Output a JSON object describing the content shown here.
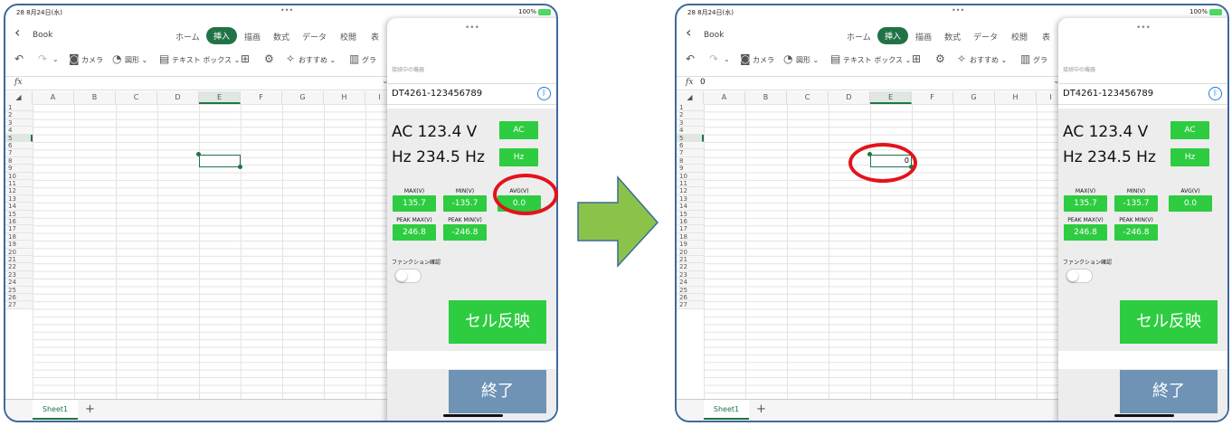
{
  "status": {
    "time": "28  8月24日(水)",
    "dots": "•••",
    "battery": "100%"
  },
  "titlebar": {
    "back": "‹",
    "book": "Book",
    "tabs": [
      "ホーム",
      "挿入",
      "描画",
      "数式",
      "データ",
      "校閲",
      "表"
    ],
    "active_tab": "挿入"
  },
  "ribbon": {
    "items": [
      "カメラ",
      "図形 ⌄",
      "テキスト ボックス ⌄",
      "おすすめ ⌄",
      "グラ"
    ]
  },
  "formula": {
    "fx": "fx",
    "left_value": "",
    "right_value": "0"
  },
  "grid": {
    "columns": [
      "A",
      "B",
      "C",
      "D",
      "E",
      "F",
      "G",
      "H",
      "I"
    ],
    "rows": [
      "1",
      "2",
      "3",
      "4",
      "5",
      "6",
      "7",
      "8",
      "9",
      "10",
      "11",
      "12",
      "13",
      "14",
      "15",
      "16",
      "17",
      "18",
      "19",
      "20",
      "21",
      "22",
      "23",
      "24",
      "25",
      "26",
      "27"
    ],
    "selected_cell": "E5",
    "left_cell_value": "",
    "right_cell_value": "0"
  },
  "sheets": {
    "tab": "Sheet1",
    "add": "+"
  },
  "panel": {
    "dots": "•••",
    "connected_label": "接続中の機器",
    "device": "DT4261-123456789",
    "ac_reading": "AC 123.4 V",
    "ac_button": "AC",
    "hz_reading": "Hz 234.5 Hz",
    "hz_button": "Hz",
    "max_label": "MAX(V)",
    "max_value": "135.7",
    "min_label": "MIN(V)",
    "min_value": "-135.7",
    "avg_label": "AVG(V)",
    "avg_value": "0.0",
    "peak_max_label": "PEAK MAX(V)",
    "peak_max_value": "246.8",
    "peak_min_label": "PEAK MIN(V)",
    "peak_min_value": "-246.8",
    "function_label": "ファンクション確認",
    "reflect_button": "セル反映",
    "end_button": "終了"
  },
  "colors": {
    "excel_green": "#217346",
    "button_green": "#2ecc40",
    "end_blue": "#6f93b5",
    "highlight_red": "#e3131b",
    "arrow_green": "#8bc34a",
    "frame_blue": "#3d6a9c"
  }
}
